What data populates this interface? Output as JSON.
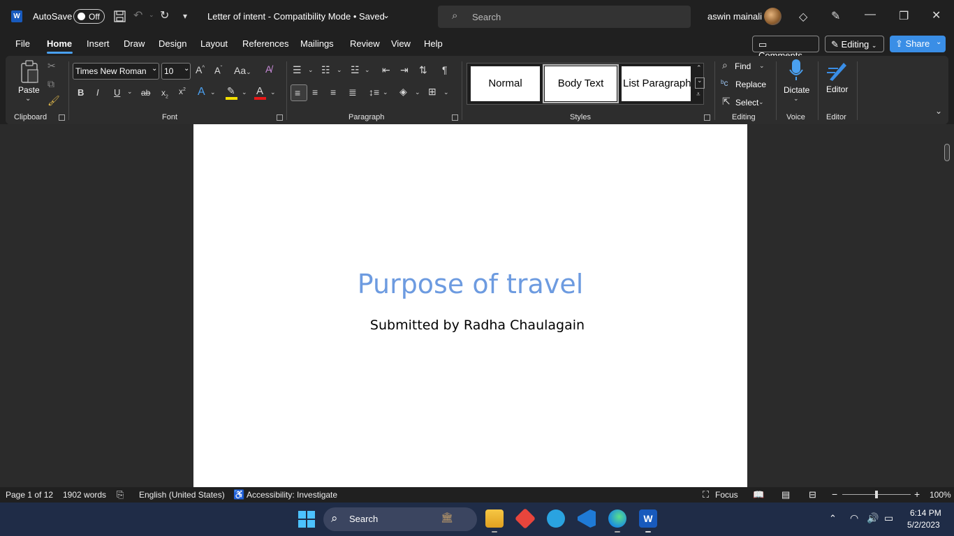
{
  "titlebar": {
    "app_logo": "W",
    "autosave_label": "AutoSave",
    "autosave_state": "Off",
    "doc_title": "Letter of intent  -  Compatibility Mode • Saved",
    "search_placeholder": "Search",
    "username": "aswin mainali"
  },
  "menu": {
    "items": [
      "File",
      "Home",
      "Insert",
      "Draw",
      "Design",
      "Layout",
      "References",
      "Mailings",
      "Review",
      "View",
      "Help"
    ],
    "active": "Home",
    "comments_label": "Comments",
    "editing_label": "Editing",
    "share_label": "Share"
  },
  "ribbon": {
    "clipboard": {
      "paste_label": "Paste",
      "group_label": "Clipboard"
    },
    "font": {
      "font_name": "Times New Roman",
      "font_size": "10",
      "group_label": "Font",
      "case_label": "Aa"
    },
    "paragraph": {
      "group_label": "Paragraph"
    },
    "styles": {
      "items": [
        "Normal",
        "Body Text",
        "List Paragraph"
      ],
      "group_label": "Styles"
    },
    "editing": {
      "find_label": "Find",
      "replace_label": "Replace",
      "select_label": "Select",
      "group_label": "Editing"
    },
    "voice": {
      "dictate_label": "Dictate",
      "group_label": "Voice"
    },
    "editor": {
      "editor_label": "Editor",
      "group_label": "Editor"
    }
  },
  "document": {
    "title": "Purpose of travel",
    "subtitle": "Submitted by Radha Chaulagain"
  },
  "status": {
    "page": "Page 1 of 12",
    "words": "1902 words",
    "language": "English (United States)",
    "accessibility": "Accessibility: Investigate",
    "focus": "Focus",
    "zoom": "100%"
  },
  "taskbar": {
    "search_label": "Search",
    "time": "6:14 PM",
    "date": "5/2/2023"
  },
  "colors": {
    "accent": "#4aa0f0",
    "title_blue": "#6d9be0",
    "share_blue": "#3a8ee6",
    "word_blue": "#185abd"
  }
}
